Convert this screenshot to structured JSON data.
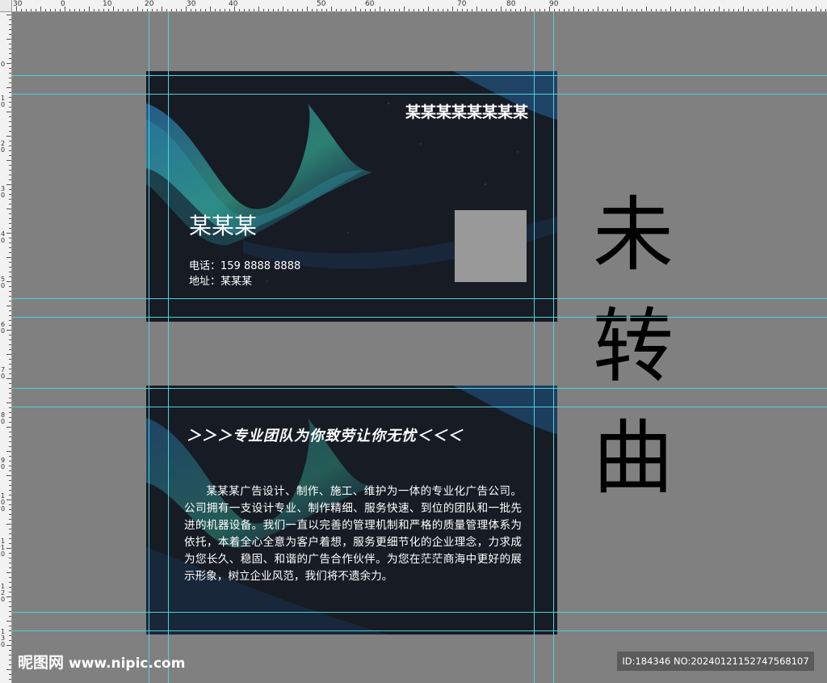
{
  "ruler": {
    "top_labels": [
      "30",
      "0",
      "10",
      "20",
      "30",
      "40",
      "50",
      "60",
      "70",
      "80",
      "90"
    ],
    "left_labels": [
      "0",
      "1 0",
      "2 0",
      "3 0",
      "4 0",
      "5 0",
      "6 0",
      "7 0",
      "8 0",
      "9 0",
      "1 0 0",
      "1 1 0",
      "1 2 0",
      "1 3 0"
    ]
  },
  "front": {
    "company_name": "某某某某某某某某",
    "person_name": "某某某",
    "phone_line": "电话：159 8888 8888",
    "address_line": "地址：某某某"
  },
  "back": {
    "slogan": "＞＞＞专业团队为你致劳让你无忧＜＜＜",
    "intro": "某某某广告设计、制作、施工、维护为一体的专业化广告公司。公司拥有一支设计专业、制作精细、服务快速、到位的团队和一批先进的机器设备。我们一直以完善的管理机制和严格的质量管理体系为依托，本着全心全意为客户着想，服务更细节化的企业理念，力求成为您长久、稳固、和谐的广告合作伙伴。为您在茫茫商海中更好的展示形象，树立企业风范，我们将不遗余力。"
  },
  "status": {
    "char1": "未",
    "char2": "转",
    "char3": "曲"
  },
  "watermark": {
    "logo": "昵图网",
    "url": "www.nipic.com",
    "id_text": "ID:184346 NO:20240121152747568107"
  },
  "colors": {
    "canvas_bg": "#808080",
    "card_bg": "#161b24",
    "guide": "#4fd1d9",
    "wave_teal": "#3fd4b0",
    "wave_blue": "#2f8fe0"
  }
}
